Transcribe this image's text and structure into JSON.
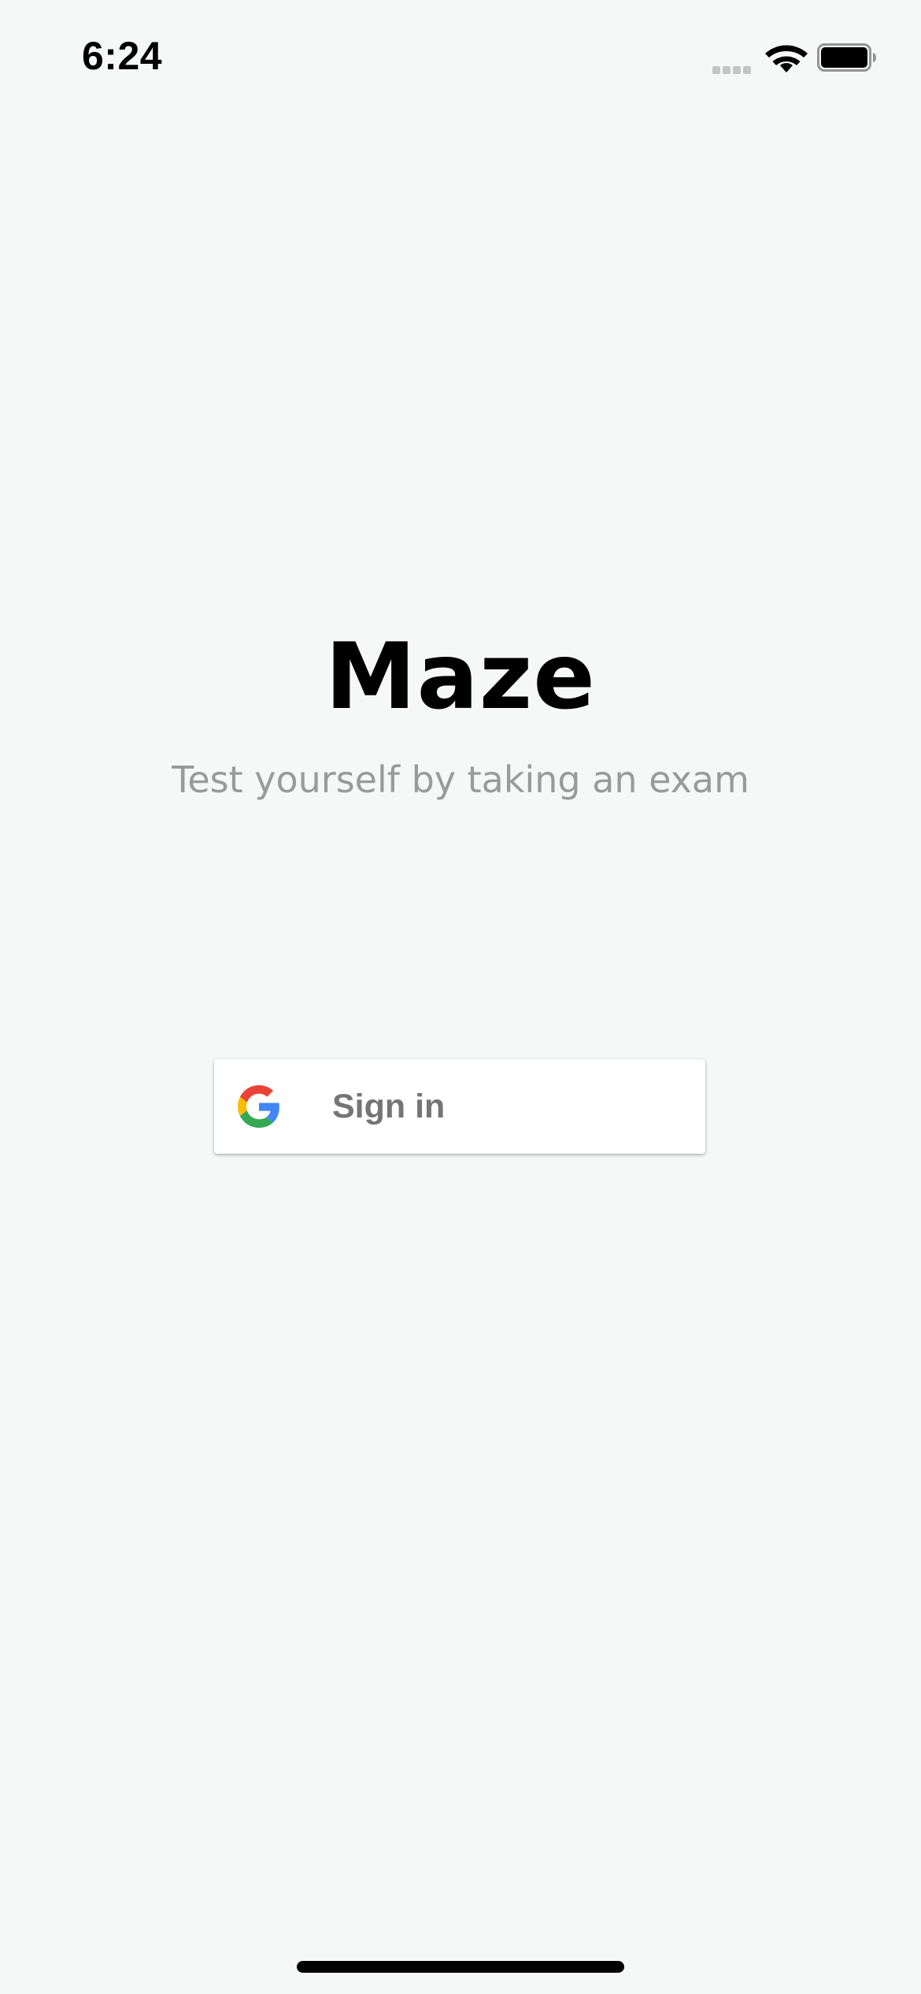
{
  "status_bar": {
    "time": "6:24",
    "icons": [
      "signal-icon",
      "wifi-icon",
      "battery-icon"
    ]
  },
  "app": {
    "title": "Maze",
    "subtitle": "Test yourself by taking an exam"
  },
  "signin": {
    "label": "Sign in",
    "icon": "google-icon"
  },
  "colors": {
    "background": "#f5f8f7",
    "subtitle": "#9a9a9a",
    "button_text": "#757575",
    "google_blue": "#4285F4",
    "google_red": "#EA4335",
    "google_yellow": "#FBBC05",
    "google_green": "#34A853"
  }
}
